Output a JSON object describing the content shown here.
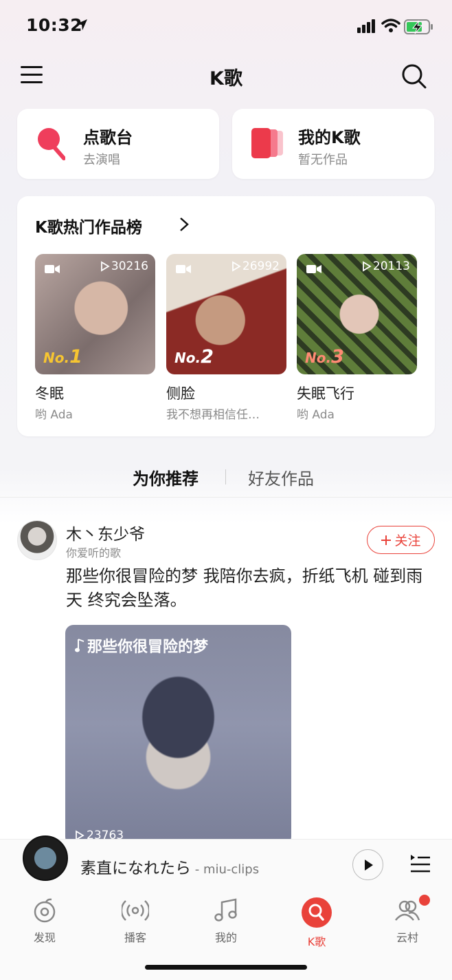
{
  "status_bar": {
    "time": "10:32"
  },
  "header": {
    "title": "K歌"
  },
  "quick_cards": [
    {
      "title": "点歌台",
      "subtitle": "去演唱",
      "icon": "microphone-icon"
    },
    {
      "title": "我的K歌",
      "subtitle": "暂无作品",
      "icon": "my-works-icon"
    }
  ],
  "hot_chart": {
    "title": "K歌热门作品榜",
    "items": [
      {
        "rank_prefix": "No.",
        "rank": "1",
        "plays": "30216",
        "song": "冬眠",
        "singer": "哟 Ada"
      },
      {
        "rank_prefix": "No.",
        "rank": "2",
        "plays": "26992",
        "song": "侧脸",
        "singer": "我不想再相信任…"
      },
      {
        "rank_prefix": "No.",
        "rank": "3",
        "plays": "20113",
        "song": "失眠飞行",
        "singer": "哟 Ada"
      }
    ]
  },
  "tabs": {
    "active": "为你推荐",
    "inactive": "好友作品"
  },
  "post": {
    "user": "木丶东少爷",
    "subtitle": "你爱听的歌",
    "follow_label": "关注",
    "text": "那些你很冒险的梦 我陪你去疯，折纸飞机 碰到雨天 终究会坠落。",
    "video_title": "那些你很冒险的梦",
    "video_plays": "23763"
  },
  "player": {
    "song": "素直になれたら",
    "artist": " - miu-clips"
  },
  "bottom_nav": [
    {
      "label": "发现",
      "icon": "discover-icon"
    },
    {
      "label": "播客",
      "icon": "podcast-icon"
    },
    {
      "label": "我的",
      "icon": "music-note-icon"
    },
    {
      "label": "K歌",
      "icon": "karaoke-icon"
    },
    {
      "label": "云村",
      "icon": "community-icon"
    }
  ],
  "colors": {
    "accent": "#e9423a",
    "rank1": "#f6c531",
    "rank3": "#ff8a73"
  }
}
